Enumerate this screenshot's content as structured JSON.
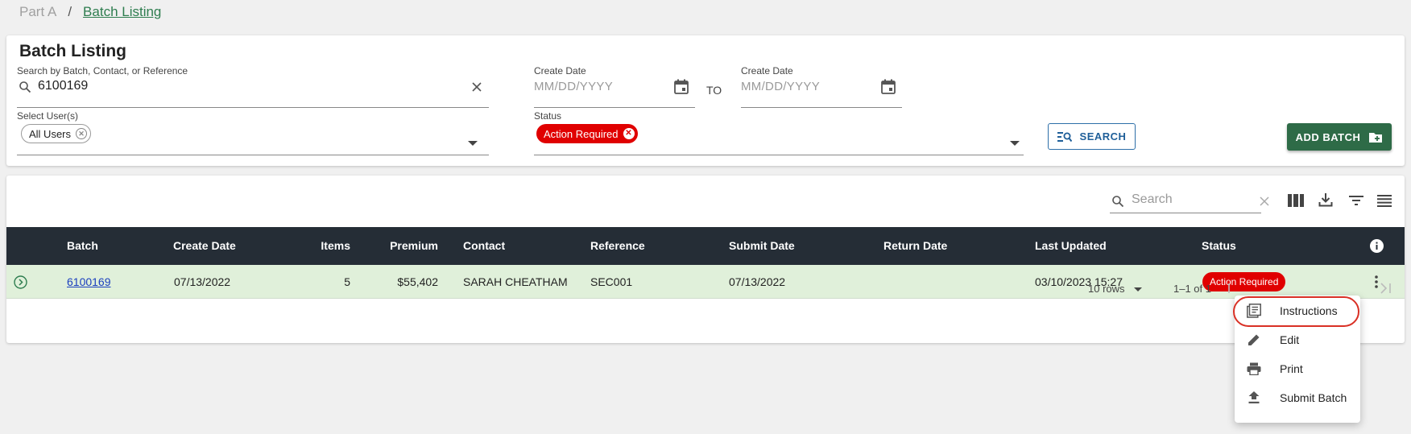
{
  "breadcrumb": {
    "root": "Part A",
    "separator": "/",
    "current": "Batch Listing"
  },
  "filters": {
    "title": "Batch Listing",
    "search_label": "Search by Batch, Contact, or Reference",
    "search_value": "6100169",
    "create_date_from_label": "Create Date",
    "create_date_from_placeholder": "MM/DD/YYYY",
    "to_label": "TO",
    "create_date_to_label": "Create Date",
    "create_date_to_placeholder": "MM/DD/YYYY",
    "users_label": "Select User(s)",
    "users_chip": "All Users",
    "status_label": "Status",
    "status_chip": "Action Required",
    "search_button": "SEARCH",
    "add_batch_button": "ADD BATCH"
  },
  "table": {
    "search_placeholder": "Search",
    "columns": [
      "Batch",
      "Create Date",
      "Items",
      "Premium",
      "Contact",
      "Reference",
      "Submit Date",
      "Return Date",
      "Last Updated",
      "Status"
    ],
    "rows": [
      {
        "batch": "6100169",
        "create_date": "07/13/2022",
        "items": "5",
        "premium": "$55,402",
        "contact": "SARAH CHEATHAM",
        "reference": "SEC001",
        "submit_date": "07/13/2022",
        "return_date": "",
        "last_updated": "03/10/2023 15:27",
        "status": "Action Required"
      }
    ],
    "pagination": {
      "rows_per_page": "10 rows",
      "range": "1–1 of 1"
    }
  },
  "row_menu": {
    "items": [
      {
        "label": "Instructions",
        "icon": "library-books-icon"
      },
      {
        "label": "Edit",
        "icon": "pencil-icon"
      },
      {
        "label": "Print",
        "icon": "printer-icon"
      },
      {
        "label": "Submit Batch",
        "icon": "upload-icon"
      }
    ]
  },
  "colors": {
    "accent_green": "#2e6b47",
    "header_dark": "#252d36",
    "status_red": "#e00000",
    "row_highlight": "#e0f0da",
    "link_blue": "#1a3fbf"
  }
}
